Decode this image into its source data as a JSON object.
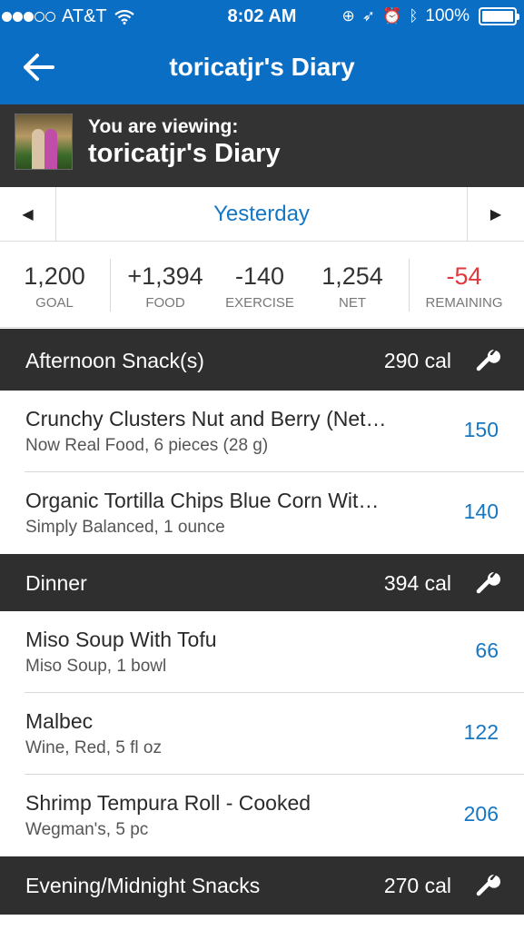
{
  "status_bar": {
    "carrier": "AT&T",
    "time": "8:02 AM",
    "battery": "100%"
  },
  "nav": {
    "title": "toricatjr's Diary"
  },
  "viewing": {
    "label": "You are viewing:",
    "name": "toricatjr's Diary"
  },
  "date": {
    "label": "Yesterday"
  },
  "summary": {
    "goal": {
      "value": "1,200",
      "label": "GOAL"
    },
    "food": {
      "value": "+1,394",
      "label": "FOOD"
    },
    "exercise": {
      "value": "-140",
      "label": "EXERCISE"
    },
    "net": {
      "value": "1,254",
      "label": "NET"
    },
    "remaining": {
      "value": "-54",
      "label": "REMAINING"
    }
  },
  "colors": {
    "brand_blue": "#0a6ec5",
    "link_blue": "#1576c2",
    "negative_red": "#e0393e",
    "section_dark": "#2f2f2f"
  },
  "sections": [
    {
      "name": "Afternoon Snack(s)",
      "calories": "290 cal",
      "entries": [
        {
          "name": "Crunchy Clusters Nut and Berry (Net…",
          "desc": "Now Real Food, 6 pieces (28 g)",
          "cal": "150"
        },
        {
          "name": "Organic Tortilla Chips Blue Corn Wit…",
          "desc": "Simply Balanced, 1 ounce",
          "cal": "140"
        }
      ]
    },
    {
      "name": "Dinner",
      "calories": "394 cal",
      "entries": [
        {
          "name": "Miso Soup With Tofu",
          "desc": "Miso Soup, 1 bowl",
          "cal": "66"
        },
        {
          "name": "Malbec",
          "desc": "Wine, Red, 5 fl oz",
          "cal": "122"
        },
        {
          "name": "Shrimp Tempura Roll - Cooked",
          "desc": "Wegman's, 5 pc",
          "cal": "206"
        }
      ]
    },
    {
      "name": "Evening/Midnight Snacks",
      "calories": "270 cal",
      "entries": []
    }
  ]
}
